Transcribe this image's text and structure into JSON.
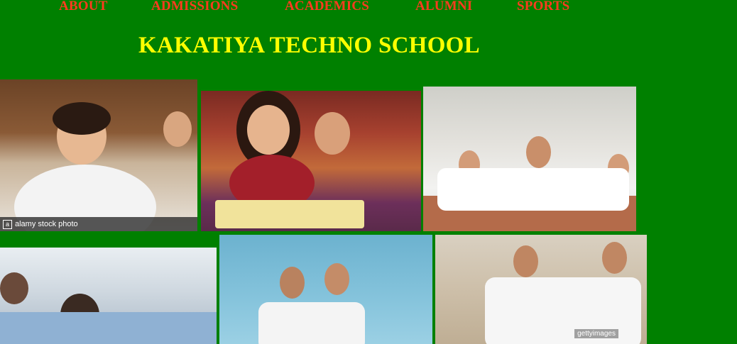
{
  "nav": {
    "about": "ABOUT",
    "admissions": "ADMISSIONS",
    "academics": "ACADEMICS",
    "alumni": "ALUMNI",
    "sports": "SPORTS"
  },
  "header": {
    "title": "KAKATIYA TECHNO SCHOOL"
  },
  "photos": {
    "library_student": {
      "watermark": "alamy stock photo"
    },
    "classroom_group": {
      "watermark": "gettyimages"
    }
  },
  "colors": {
    "page_background": "#008000",
    "nav_text": "#ff3b1f",
    "title_text": "#ffff00"
  }
}
